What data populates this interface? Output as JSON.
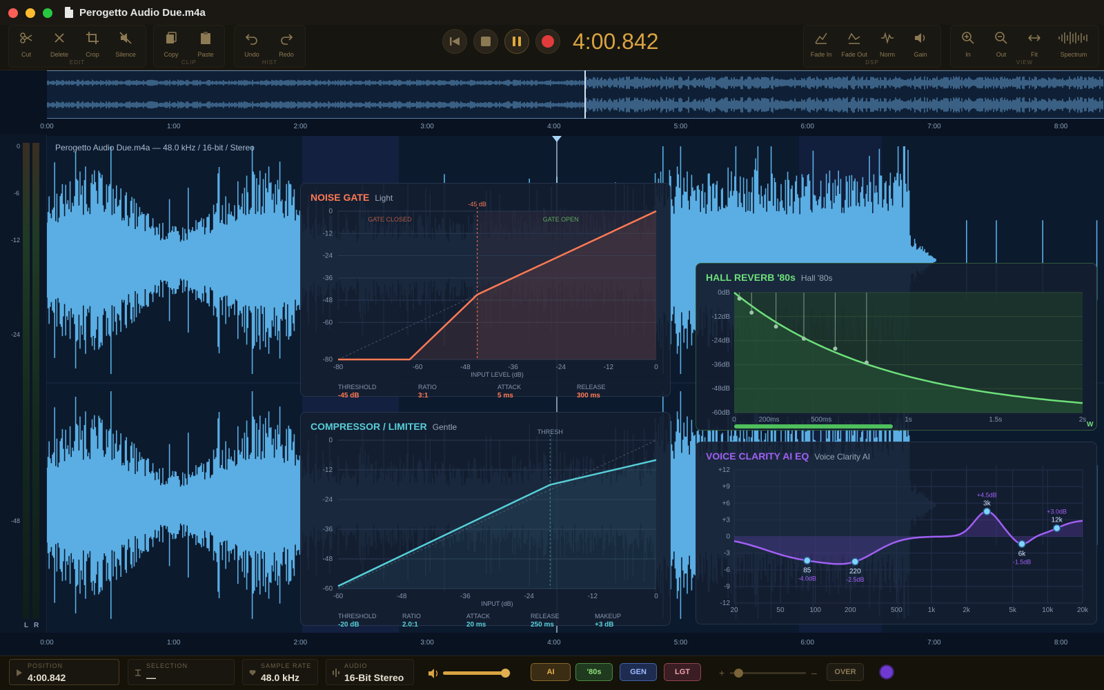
{
  "window": {
    "title": "Perogetto Audio Due.m4a"
  },
  "toolbar": {
    "edit": {
      "label": "EDIT",
      "cut": "Cut",
      "delete": "Delete",
      "crop": "Crop",
      "silence": "Silence"
    },
    "clip": {
      "label": "CLIP",
      "copy": "Copy",
      "paste": "Paste"
    },
    "hist": {
      "label": "HIST",
      "undo": "Undo",
      "redo": "Redo"
    },
    "dsp": {
      "label": "DSP",
      "fade_in": "Fade In",
      "fade_out": "Fade Out",
      "norm": "Norm",
      "gain": "Gain"
    },
    "view": {
      "label": "VIEW",
      "zoom_in": "In",
      "zoom_out": "Out",
      "fit": "Fit",
      "spectrum": "Spectrum"
    }
  },
  "transport": {
    "time": "4:00.842"
  },
  "timeline": {
    "ticks": [
      "0:00",
      "1:00",
      "2:00",
      "3:00",
      "4:00",
      "5:00",
      "6:00",
      "7:00",
      "8:00"
    ],
    "playhead_fraction": 0.484
  },
  "meter": {
    "scale": [
      "0",
      "-6",
      "-12",
      "-24",
      "-48"
    ],
    "left": "L",
    "right": "R"
  },
  "track": {
    "info": "Perogetto Audio Due.m4a — 48.0 kHz / 16-bit / Stereo"
  },
  "noise_gate": {
    "title": "NOISE GATE",
    "preset": "Light",
    "marker": "-45 dB",
    "zone_closed": "GATE CLOSED",
    "zone_open": "GATE OPEN",
    "y_ticks": [
      "0",
      "-12",
      "-24",
      "-36",
      "-48",
      "-60",
      "-80"
    ],
    "x_ticks": [
      "-80",
      "-60",
      "-48",
      "-36",
      "-24",
      "-12",
      "0"
    ],
    "x_label": "INPUT LEVEL (dB)",
    "params": [
      {
        "label": "THRESHOLD",
        "value": "-45 dB"
      },
      {
        "label": "RATIO",
        "value": "3:1"
      },
      {
        "label": "ATTACK",
        "value": "5 ms"
      },
      {
        "label": "RELEASE",
        "value": "300 ms"
      }
    ]
  },
  "compressor": {
    "title": "COMPRESSOR / LIMITER",
    "preset": "Gentle",
    "marker": "THRESH",
    "y_ticks": [
      "0",
      "-12",
      "-24",
      "-36",
      "-48",
      "-60"
    ],
    "x_ticks": [
      "-60",
      "-48",
      "-36",
      "-24",
      "-12",
      "0"
    ],
    "x_label": "INPUT (dB)",
    "params": [
      {
        "label": "THRESHOLD",
        "value": "-20 dB"
      },
      {
        "label": "RATIO",
        "value": "2.0:1"
      },
      {
        "label": "ATTACK",
        "value": "20 ms"
      },
      {
        "label": "RELEASE",
        "value": "250 ms"
      },
      {
        "label": "MAKEUP",
        "value": "+3 dB"
      }
    ]
  },
  "reverb": {
    "title": "HALL REVERB '80s",
    "preset": "Hall '80s",
    "y_ticks": [
      "0dB",
      "-12dB",
      "-24dB",
      "-36dB",
      "-48dB",
      "-60dB"
    ],
    "x_ticks": [
      "0",
      "200ms",
      "500ms",
      "1s",
      "1.5s",
      "2s"
    ],
    "mix_label": "W"
  },
  "eq": {
    "title": "VOICE CLARITY AI EQ",
    "preset": "Voice Clarity AI",
    "y_ticks": [
      "+12",
      "+9",
      "+6",
      "+3",
      "0",
      "-3",
      "-6",
      "-9",
      "-12"
    ],
    "x_ticks": [
      "20",
      "50",
      "100",
      "200",
      "500",
      "1k",
      "2k",
      "5k",
      "10k",
      "20k"
    ],
    "bands": [
      {
        "freq": "85",
        "gain": "-4.0dB"
      },
      {
        "freq": "220",
        "gain": "-2.5dB"
      },
      {
        "freq": "3k",
        "gain": "+4.5dB"
      },
      {
        "freq": "6k",
        "gain": "-1.5dB"
      },
      {
        "freq": "12k",
        "gain": "+3.0dB"
      }
    ]
  },
  "status": {
    "position": {
      "label": "POSITION",
      "value": "4:00.842"
    },
    "selection": {
      "label": "SELECTION",
      "value": "—"
    },
    "sample_rate": {
      "label": "SAMPLE RATE",
      "value": "48.0 kHz"
    },
    "audio": {
      "label": "AUDIO",
      "value": "16-Bit Stereo"
    },
    "volume_level": 0.92,
    "pills": {
      "ai": "AI",
      "eighties": "'80s",
      "gen": "GEN",
      "lgt": "LGT",
      "over": "OVER"
    },
    "pan_minus": "–",
    "pan_plus": "+"
  },
  "colors": {
    "accent": "#d9a441",
    "wave": "#5aaee3",
    "gate": "#ff7a55",
    "comp": "#56cfd8",
    "reverb": "#5fd46a",
    "eq": "#a160f5",
    "record": "#e23b3b"
  }
}
